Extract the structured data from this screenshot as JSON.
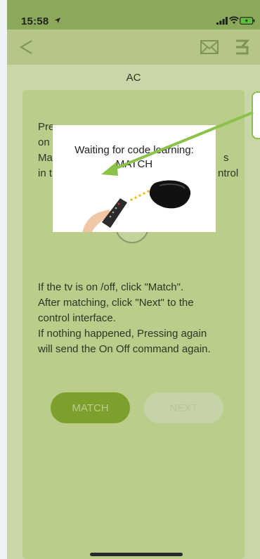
{
  "status_bar": {
    "time": "15:58"
  },
  "header": {
    "title": "AC"
  },
  "instructions": {
    "lines": [
      "Pre",
      "on",
      "Ma",
      "in t"
    ],
    "right_fragments": [
      "s",
      "ntrol"
    ]
  },
  "help": {
    "lines": [
      "If the tv is on /off,  click \"Match\".",
      "After matching,  click \"Next\" to the",
      "control interface.",
      "If nothing happened,  Pressing again",
      "will send the On Off command again."
    ]
  },
  "buttons": {
    "match": "MATCH",
    "next": "NEXT"
  },
  "popup": {
    "title": "Waiting for code learning:",
    "subtitle": "MATCH"
  },
  "colors": {
    "accent": "#7d9f2c",
    "annotation": "#8bc34a"
  },
  "icons": [
    "back-arrow-icon",
    "mail-icon",
    "menu-icon",
    "remote-control-icon",
    "ir-hub-icon"
  ]
}
